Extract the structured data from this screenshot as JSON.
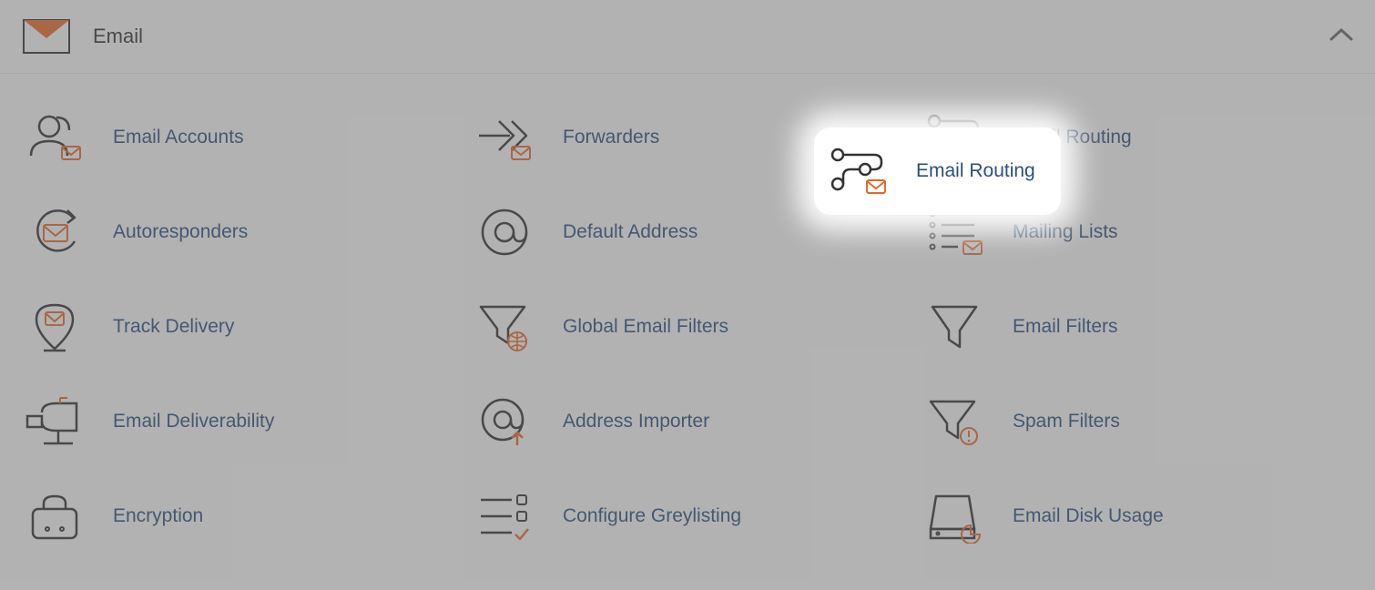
{
  "header": {
    "title": "Email"
  },
  "items": [
    {
      "label": "Email Accounts",
      "name": "email-accounts"
    },
    {
      "label": "Forwarders",
      "name": "forwarders"
    },
    {
      "label": "Email Routing",
      "name": "email-routing"
    },
    {
      "label": "Autoresponders",
      "name": "autoresponders"
    },
    {
      "label": "Default Address",
      "name": "default-address"
    },
    {
      "label": "Mailing Lists",
      "name": "mailing-lists"
    },
    {
      "label": "Track Delivery",
      "name": "track-delivery"
    },
    {
      "label": "Global Email Filters",
      "name": "global-email-filters"
    },
    {
      "label": "Email Filters",
      "name": "email-filters"
    },
    {
      "label": "Email Deliverability",
      "name": "email-deliverability"
    },
    {
      "label": "Address Importer",
      "name": "address-importer"
    },
    {
      "label": "Spam Filters",
      "name": "spam-filters"
    },
    {
      "label": "Encryption",
      "name": "encryption"
    },
    {
      "label": "Configure Greylisting",
      "name": "configure-greylisting"
    },
    {
      "label": "Email Disk Usage",
      "name": "email-disk-usage"
    }
  ],
  "highlight": {
    "label": "Email Routing"
  }
}
